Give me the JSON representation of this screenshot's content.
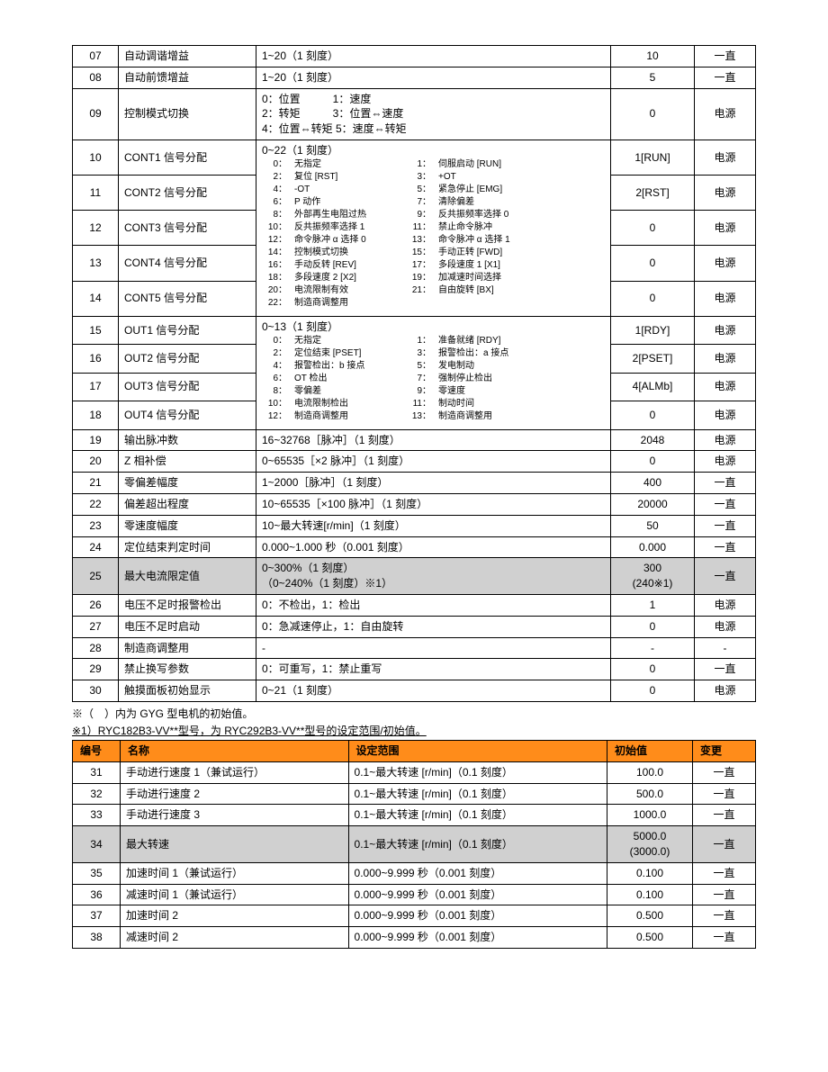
{
  "table1": {
    "rows": [
      {
        "no": "07",
        "name": "自动调谐增益",
        "range": "1~20（1 刻度）",
        "def": "10",
        "chg": "一直",
        "gray": false,
        "span": 1
      },
      {
        "no": "08",
        "name": "自动前馈增益",
        "range": "1~20（1 刻度）",
        "def": "5",
        "chg": "一直",
        "gray": false,
        "span": 1
      },
      {
        "no": "09",
        "name": "控制模式切换",
        "range": "0：位置　　　1：速度\n2：转矩　　　3：位置⇔速度\n4：位置⇔转矩 5：速度⇔转矩",
        "def": "0",
        "chg": "电源",
        "gray": false,
        "span": 1
      },
      {
        "no": "10",
        "name": "CONT1 信号分配",
        "range": "",
        "def": "1[RUN]",
        "chg": "电源",
        "gray": false,
        "span": 1,
        "group": "cont"
      },
      {
        "no": "11",
        "name": "CONT2 信号分配",
        "range": "",
        "def": "2[RST]",
        "chg": "电源",
        "gray": false,
        "span": 1,
        "group": "cont"
      },
      {
        "no": "12",
        "name": "CONT3 信号分配",
        "range": "",
        "def": "0",
        "chg": "电源",
        "gray": false,
        "span": 1,
        "group": "cont"
      },
      {
        "no": "13",
        "name": "CONT4 信号分配",
        "range": "",
        "def": "0",
        "chg": "电源",
        "gray": false,
        "span": 1,
        "group": "cont"
      },
      {
        "no": "14",
        "name": "CONT5 信号分配",
        "range": "",
        "def": "0",
        "chg": "电源",
        "gray": false,
        "span": 1,
        "group": "cont"
      },
      {
        "no": "15",
        "name": "OUT1 信号分配",
        "range": "",
        "def": "1[RDY]",
        "chg": "电源",
        "gray": false,
        "span": 1,
        "group": "out"
      },
      {
        "no": "16",
        "name": "OUT2 信号分配",
        "range": "",
        "def": "2[PSET]",
        "chg": "电源",
        "gray": false,
        "span": 1,
        "group": "out"
      },
      {
        "no": "17",
        "name": "OUT3 信号分配",
        "range": "",
        "def": "4[ALMb]",
        "chg": "电源",
        "gray": false,
        "span": 1,
        "group": "out"
      },
      {
        "no": "18",
        "name": "OUT4 信号分配",
        "range": "",
        "def": "0",
        "chg": "电源",
        "gray": false,
        "span": 1,
        "group": "out"
      },
      {
        "no": "19",
        "name": "输出脉冲数",
        "range": "16~32768［脉冲］（1 刻度）",
        "def": "2048",
        "chg": "电源",
        "gray": false,
        "span": 1
      },
      {
        "no": "20",
        "name": "Z 相补偿",
        "range": "0~65535［×2 脉冲］（1 刻度）",
        "def": "0",
        "chg": "电源",
        "gray": false,
        "span": 1
      },
      {
        "no": "21",
        "name": "零偏差幅度",
        "range": "1~2000［脉冲］（1 刻度）",
        "def": "400",
        "chg": "一直",
        "gray": false,
        "span": 1
      },
      {
        "no": "22",
        "name": "偏差超出程度",
        "range": "10~65535［×100 脉冲］（1 刻度）",
        "def": "20000",
        "chg": "一直",
        "gray": false,
        "span": 1
      },
      {
        "no": "23",
        "name": "零速度幅度",
        "range": "10~最大转速[r/min]（1 刻度）",
        "def": "50",
        "chg": "一直",
        "gray": false,
        "span": 1
      },
      {
        "no": "24",
        "name": "定位结束判定时间",
        "range": "0.000~1.000 秒（0.001 刻度）",
        "def": "0.000",
        "chg": "一直",
        "gray": false,
        "span": 1
      },
      {
        "no": "25",
        "name": "最大电流限定值",
        "range": "0~300%（1 刻度）\n（0~240%（1 刻度）※1）",
        "def": "300\n(240※1)",
        "chg": "一直",
        "gray": true,
        "span": 1
      },
      {
        "no": "26",
        "name": "电压不足时报警检出",
        "range": "0：不检出，1：检出",
        "def": "1",
        "chg": "电源",
        "gray": false,
        "span": 1
      },
      {
        "no": "27",
        "name": "电压不足时启动",
        "range": "0：急减速停止，1：自由旋转",
        "def": "0",
        "chg": "电源",
        "gray": false,
        "span": 1
      },
      {
        "no": "28",
        "name": "制造商调整用",
        "range": "-",
        "def": "-",
        "chg": "-",
        "gray": false,
        "span": 1
      },
      {
        "no": "29",
        "name": "禁止换写参数",
        "range": "0：可重写，1：禁止重写",
        "def": "0",
        "chg": "一直",
        "gray": false,
        "span": 1
      },
      {
        "no": "30",
        "name": "触摸面板初始显示",
        "range": "0~21（1 刻度）",
        "def": "0",
        "chg": "电源",
        "gray": false,
        "span": 1
      }
    ],
    "cont_header": "0~22（1 刻度）",
    "cont_list": [
      [
        "0：",
        "无指定",
        "1：",
        "伺服启动 [RUN]"
      ],
      [
        "2：",
        "复位 [RST]",
        "3：",
        "+OT"
      ],
      [
        "4：",
        "-OT",
        "5：",
        "紧急停止 [EMG]"
      ],
      [
        "6：",
        "P 动作",
        "7：",
        "清除偏差"
      ],
      [
        "8：",
        "外部再生电阻过热",
        "9：",
        "反共振频率选择 0"
      ],
      [
        "10：",
        "反共振频率选择 1",
        "11：",
        "禁止命令脉冲"
      ],
      [
        "12：",
        "命令脉冲 α 选择 0",
        "13：",
        "命令脉冲 α 选择 1"
      ],
      [
        "14：",
        "控制模式切换",
        "15：",
        "手动正转 [FWD]"
      ],
      [
        "16：",
        "手动反转 [REV]",
        "17：",
        "多段速度 1 [X1]"
      ],
      [
        "18：",
        "多段速度 2 [X2]",
        "19：",
        "加减速时间选择"
      ],
      [
        "20：",
        "电流限制有效",
        "21：",
        "自由旋转 [BX]"
      ],
      [
        "22：",
        "制造商调整用",
        "",
        ""
      ]
    ],
    "out_header": "0~13（1 刻度）",
    "out_list": [
      [
        "0：",
        "无指定",
        "1：",
        "准备就绪 [RDY]"
      ],
      [
        "2：",
        "定位结束 [PSET]",
        "3：",
        "报警检出：a 接点"
      ],
      [
        "4：",
        "报警检出：b 接点",
        "5：",
        "发电制动"
      ],
      [
        "6：",
        "OT 检出",
        "7：",
        "强制停止检出"
      ],
      [
        "8：",
        "零偏差",
        "9：",
        "零速度"
      ],
      [
        "10：",
        "电流限制检出",
        "11：",
        "制动时间"
      ],
      [
        "12：",
        "制造商调整用",
        "13：",
        "制造商调整用"
      ]
    ]
  },
  "note1": "※（　）内为 GYG 型电机的初始值。",
  "note2": "※1）RYC182B3-VV**型号，为 RYC292B3-VV**型号的设定范围/初始值。",
  "table2": {
    "headers": [
      "编号",
      "名称",
      "设定范围",
      "初始值",
      "变更"
    ],
    "rows": [
      {
        "no": "31",
        "name": "手动进行速度 1（兼试运行）",
        "range": "0.1~最大转速 [r/min]（0.1 刻度）",
        "def": "100.0",
        "chg": "一直",
        "gray": false
      },
      {
        "no": "32",
        "name": "手动进行速度 2",
        "range": "0.1~最大转速 [r/min]（0.1 刻度）",
        "def": "500.0",
        "chg": "一直",
        "gray": false
      },
      {
        "no": "33",
        "name": "手动进行速度 3",
        "range": "0.1~最大转速 [r/min]（0.1 刻度）",
        "def": "1000.0",
        "chg": "一直",
        "gray": false
      },
      {
        "no": "34",
        "name": "最大转速",
        "range": "0.1~最大转速 [r/min]（0.1 刻度）",
        "def": "5000.0\n(3000.0)",
        "chg": "一直",
        "gray": true
      },
      {
        "no": "35",
        "name": "加速时间 1（兼试运行）",
        "range": "0.000~9.999 秒（0.001 刻度）",
        "def": "0.100",
        "chg": "一直",
        "gray": false
      },
      {
        "no": "36",
        "name": "减速时间 1（兼试运行）",
        "range": "0.000~9.999 秒（0.001 刻度）",
        "def": "0.100",
        "chg": "一直",
        "gray": false
      },
      {
        "no": "37",
        "name": "加速时间 2",
        "range": "0.000~9.999 秒（0.001 刻度）",
        "def": "0.500",
        "chg": "一直",
        "gray": false
      },
      {
        "no": "38",
        "name": "减速时间 2",
        "range": "0.000~9.999 秒（0.001 刻度）",
        "def": "0.500",
        "chg": "一直",
        "gray": false
      }
    ]
  }
}
